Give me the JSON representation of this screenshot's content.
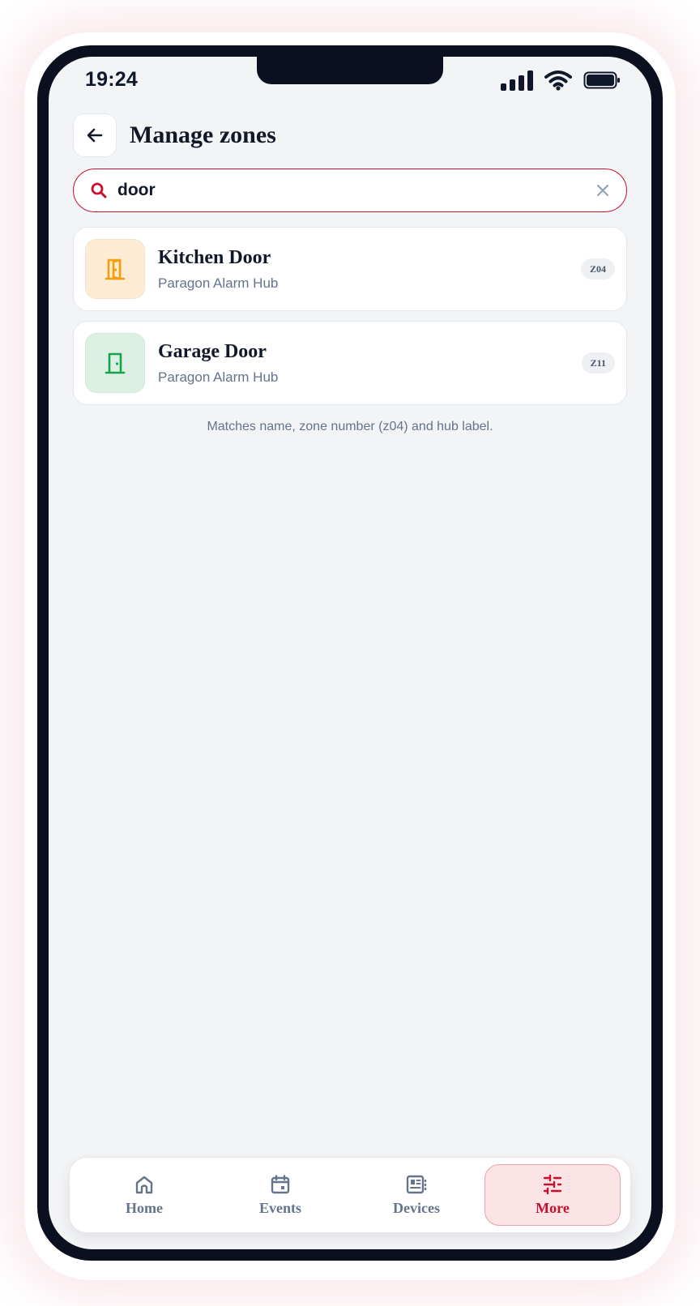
{
  "status_bar": {
    "time": "19:24"
  },
  "header": {
    "title": "Manage zones",
    "back_icon": "arrow-left-icon"
  },
  "search": {
    "value": "door",
    "placeholder": "",
    "icon": "search-icon",
    "clear_icon": "close-icon"
  },
  "zones": [
    {
      "name": "Kitchen Door",
      "hub": "Paragon Alarm Hub",
      "badge": "Z04",
      "icon": "door-open-icon",
      "icon_color": "#f59e0b",
      "icon_bg": "#fdebd4"
    },
    {
      "name": "Garage Door",
      "hub": "Paragon Alarm Hub",
      "badge": "Z11",
      "icon": "door-icon",
      "icon_color": "#16a34a",
      "icon_bg": "#dcf1e3"
    }
  ],
  "hint": "Matches name, zone number (z04) and hub label.",
  "tab_bar": {
    "tabs": [
      {
        "label": "Home",
        "icon": "home-icon",
        "active": false
      },
      {
        "label": "Events",
        "icon": "calendar-icon",
        "active": false
      },
      {
        "label": "Devices",
        "icon": "devices-icon",
        "active": false
      },
      {
        "label": "More",
        "icon": "sliders-icon",
        "active": true
      }
    ]
  },
  "colors": {
    "accent": "#c8102e",
    "text_primary": "#111827",
    "text_muted": "#64748b",
    "background": "#f3f4f6"
  }
}
